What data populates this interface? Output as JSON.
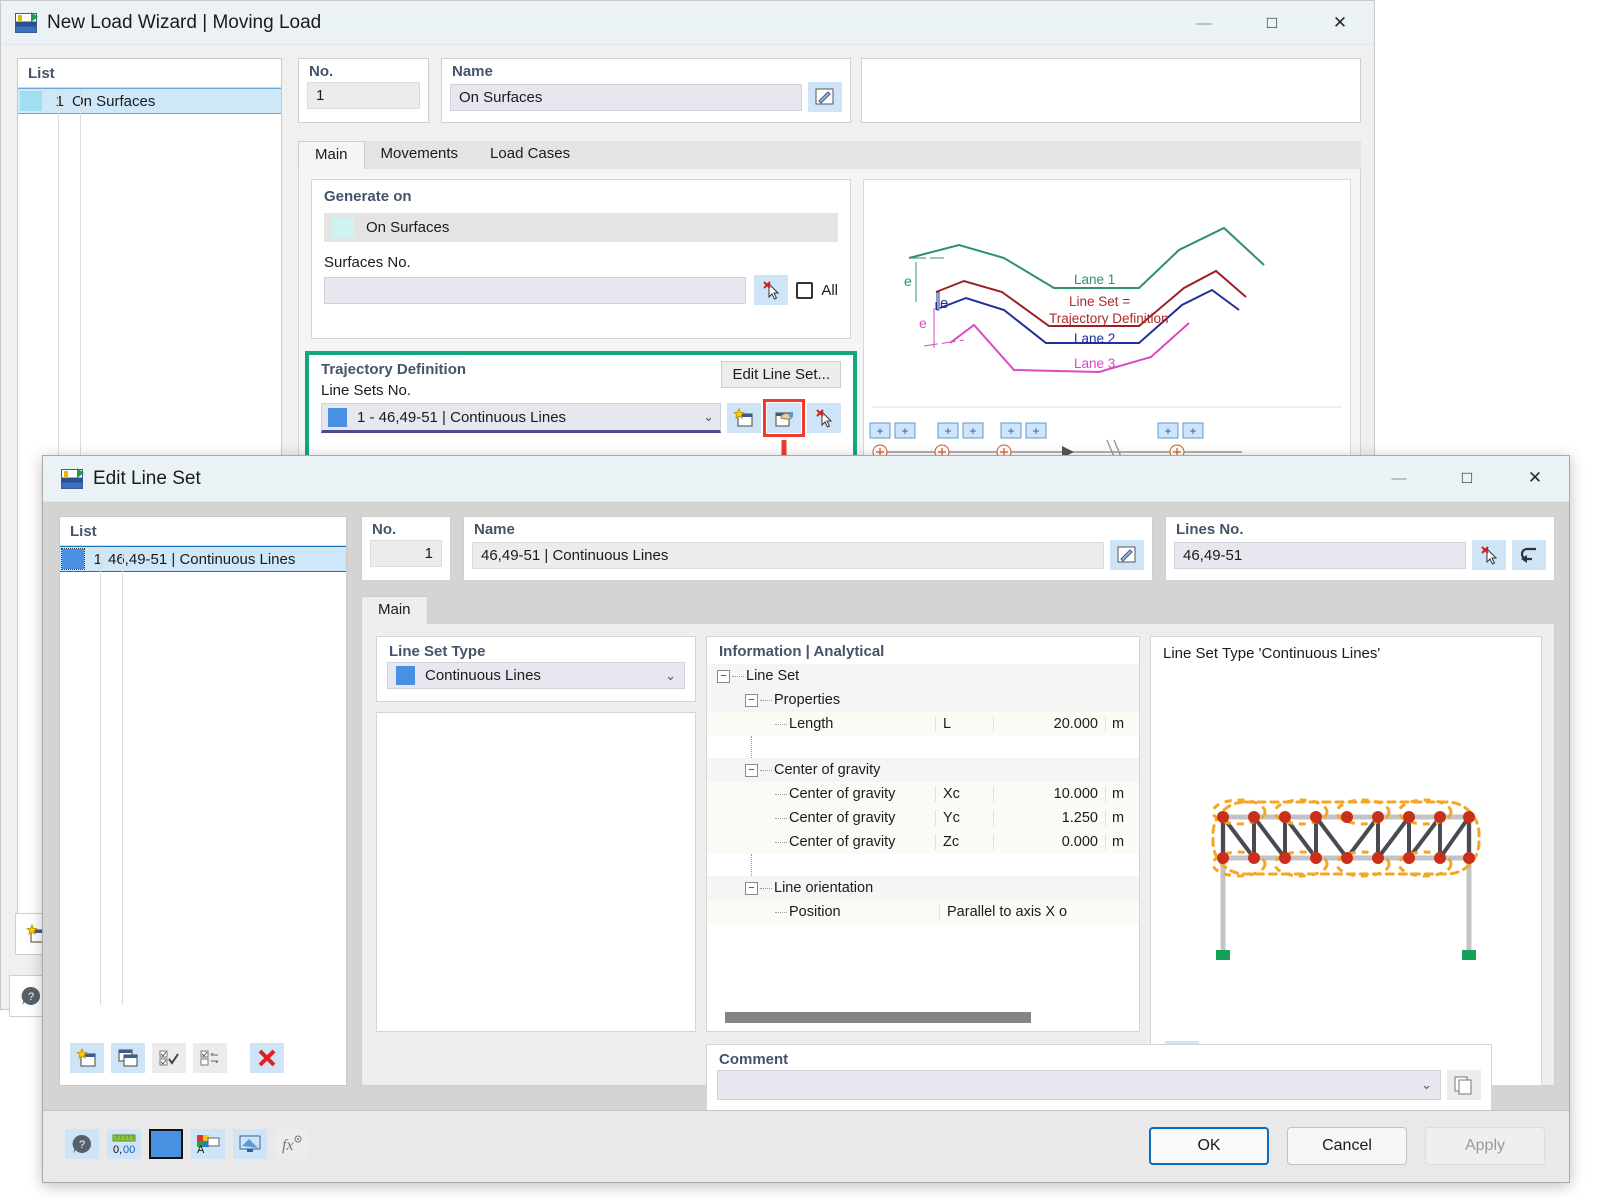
{
  "wizard": {
    "title": "New Load Wizard | Moving Load",
    "window_controls": {
      "minimize": "—",
      "maximize": "□",
      "close": "✕"
    },
    "list_header": "List",
    "list_items": [
      {
        "num": "1",
        "label": "On Surfaces"
      }
    ],
    "no_label": "No.",
    "no_value": "1",
    "name_label": "Name",
    "name_value": "On Surfaces",
    "tabs": [
      {
        "label": "Main",
        "active": true
      },
      {
        "label": "Movements",
        "active": false
      },
      {
        "label": "Load Cases",
        "active": false
      }
    ],
    "generate_on": {
      "title": "Generate on",
      "selected": "On Surfaces",
      "surfaces_label": "Surfaces No.",
      "surfaces_value": "",
      "all_label": "All"
    },
    "trajectory": {
      "title": "Trajectory Definition",
      "line_sets_label": "Line Sets No.",
      "line_sets_value": "1 - 46,49-51 | Continuous Lines",
      "edit_button": "Edit Line Set..."
    },
    "diagram": {
      "lane1": "Lane 1",
      "lane2": "Lane 2",
      "lane3": "Lane 3",
      "note_line1": "Line Set =",
      "note_line2": "Trajectory Definition",
      "e_label": "e"
    }
  },
  "dialog": {
    "title": "Edit Line Set",
    "window_controls": {
      "minimize": "—",
      "maximize": "□",
      "close": "✕"
    },
    "list_header": "List",
    "list_items": [
      {
        "num": "1",
        "label": "46,49-51 | Continuous Lines"
      }
    ],
    "no_label": "No.",
    "no_value": "1",
    "name_label": "Name",
    "name_value": "46,49-51 | Continuous Lines",
    "lines_no_label": "Lines No.",
    "lines_no_value": "46,49-51",
    "tabs": [
      {
        "label": "Main",
        "active": true
      }
    ],
    "line_set_type": {
      "title": "Line Set Type",
      "value": "Continuous Lines",
      "swatch_color": "#4a90e2"
    },
    "information": {
      "title": "Information | Analytical",
      "rows": [
        {
          "kind": "group",
          "indent": 0,
          "label": "Line Set"
        },
        {
          "kind": "group",
          "indent": 1,
          "label": "Properties"
        },
        {
          "kind": "value",
          "indent": 2,
          "label": "Length",
          "symbol": "L",
          "value": "20.000",
          "unit": "m"
        },
        {
          "kind": "gap"
        },
        {
          "kind": "group",
          "indent": 1,
          "label": "Center of gravity"
        },
        {
          "kind": "value",
          "indent": 2,
          "label": "Center of gravity",
          "symbol": "Xc",
          "value": "10.000",
          "unit": "m"
        },
        {
          "kind": "value",
          "indent": 2,
          "label": "Center of gravity",
          "symbol": "Yc",
          "value": "1.250",
          "unit": "m"
        },
        {
          "kind": "value",
          "indent": 2,
          "label": "Center of gravity",
          "symbol": "Zc",
          "value": "0.000",
          "unit": "m"
        },
        {
          "kind": "gap"
        },
        {
          "kind": "group",
          "indent": 1,
          "label": "Line orientation"
        },
        {
          "kind": "value",
          "indent": 2,
          "label": "Position",
          "symbol": "",
          "value": "Parallel to axis X o",
          "unit": ""
        }
      ]
    },
    "right_preview_title": "Line Set Type 'Continuous Lines'",
    "comment": {
      "title": "Comment",
      "value": "",
      "placeholder": ""
    },
    "footer": {
      "ok": "OK",
      "cancel": "Cancel",
      "apply": "Apply"
    }
  }
}
